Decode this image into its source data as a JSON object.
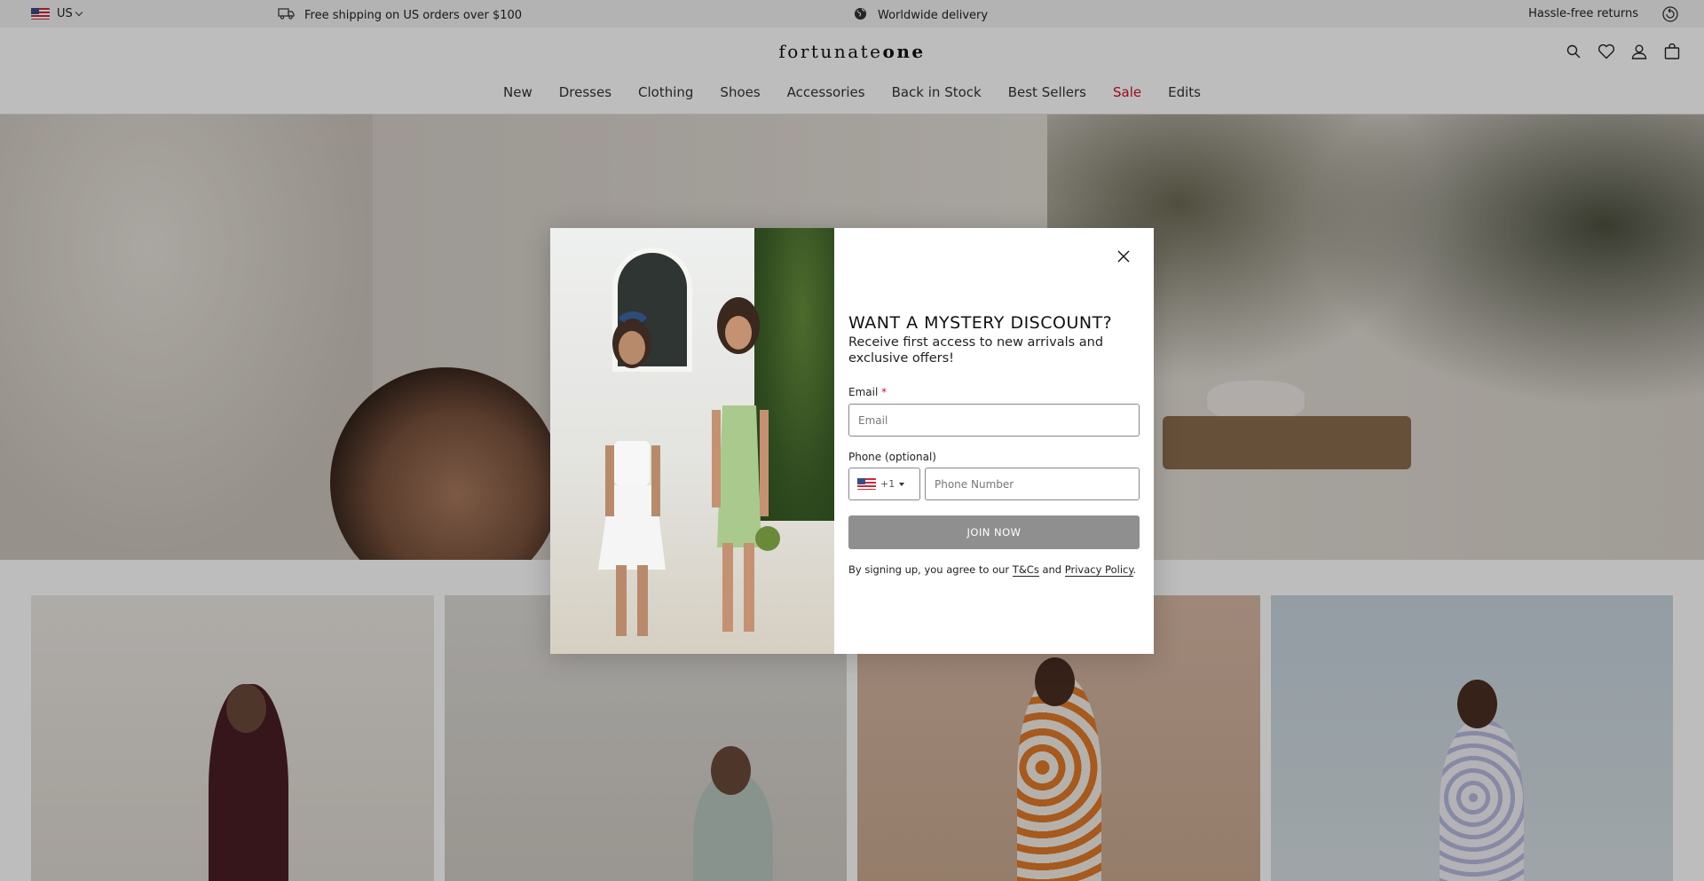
{
  "topbar": {
    "country": "US",
    "shipping": "Free shipping on US orders over $100",
    "delivery": "Worldwide delivery",
    "returns": "Hassle-free returns"
  },
  "header": {
    "logo_light": "fortunate",
    "logo_bold": "one",
    "icons": [
      "search-icon",
      "heart-icon",
      "account-icon",
      "bag-icon"
    ]
  },
  "nav": {
    "items": [
      "New",
      "Dresses",
      "Clothing",
      "Shoes",
      "Accessories",
      "Back in Stock",
      "Best Sellers",
      "Sale",
      "Edits"
    ],
    "sale_color": "#c8102e"
  },
  "modal": {
    "title": "WANT A MYSTERY DISCOUNT?",
    "subtitle": "Receive first access to new arrivals and exclusive offers!",
    "email_label": "Email",
    "email_required_mark": "*",
    "email_placeholder": "Email",
    "phone_label": "Phone (optional)",
    "country_code": "+1",
    "phone_placeholder": "Phone Number",
    "join_label": "JOIN NOW",
    "legal_prefix": "By signing up, you agree to our",
    "legal_terms": "T&Cs",
    "legal_and": "and",
    "legal_privacy": "Privacy Policy",
    "legal_suffix": "."
  }
}
